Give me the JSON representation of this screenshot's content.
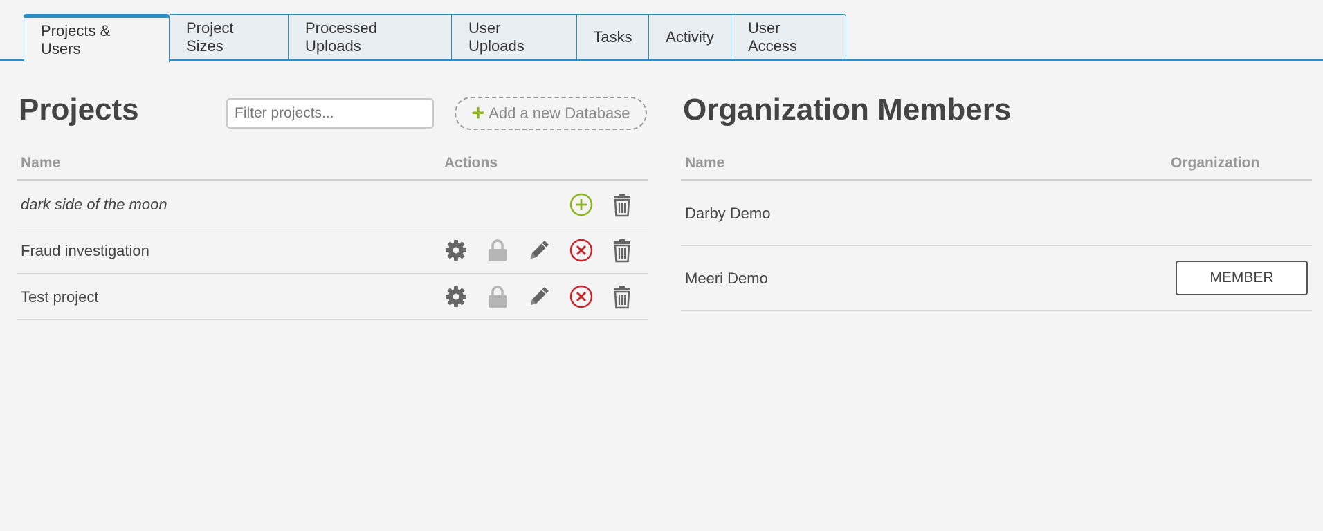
{
  "tabs": [
    "Projects & Users",
    "Project Sizes",
    "Processed Uploads",
    "User Uploads",
    "Tasks",
    "Activity",
    "User Access"
  ],
  "projects": {
    "title": "Projects",
    "filter_placeholder": "Filter projects...",
    "add_label": "Add a new Database",
    "col_name": "Name",
    "col_actions": "Actions",
    "rows": [
      "dark side of the moon",
      "Fraud investigation",
      "Test project"
    ]
  },
  "members": {
    "title": "Organization Members",
    "col_name": "Name",
    "col_org": "Organization",
    "rows": [
      {
        "name": "Darby Demo",
        "role": ""
      },
      {
        "name": "Meeri Demo",
        "role": "MEMBER"
      }
    ]
  },
  "colors": {
    "accent": "#2a8fc7",
    "add_green": "#8db31d",
    "remove_red": "#c9262b",
    "icon_grey": "#666666",
    "lock_grey": "#b5b5b5"
  }
}
